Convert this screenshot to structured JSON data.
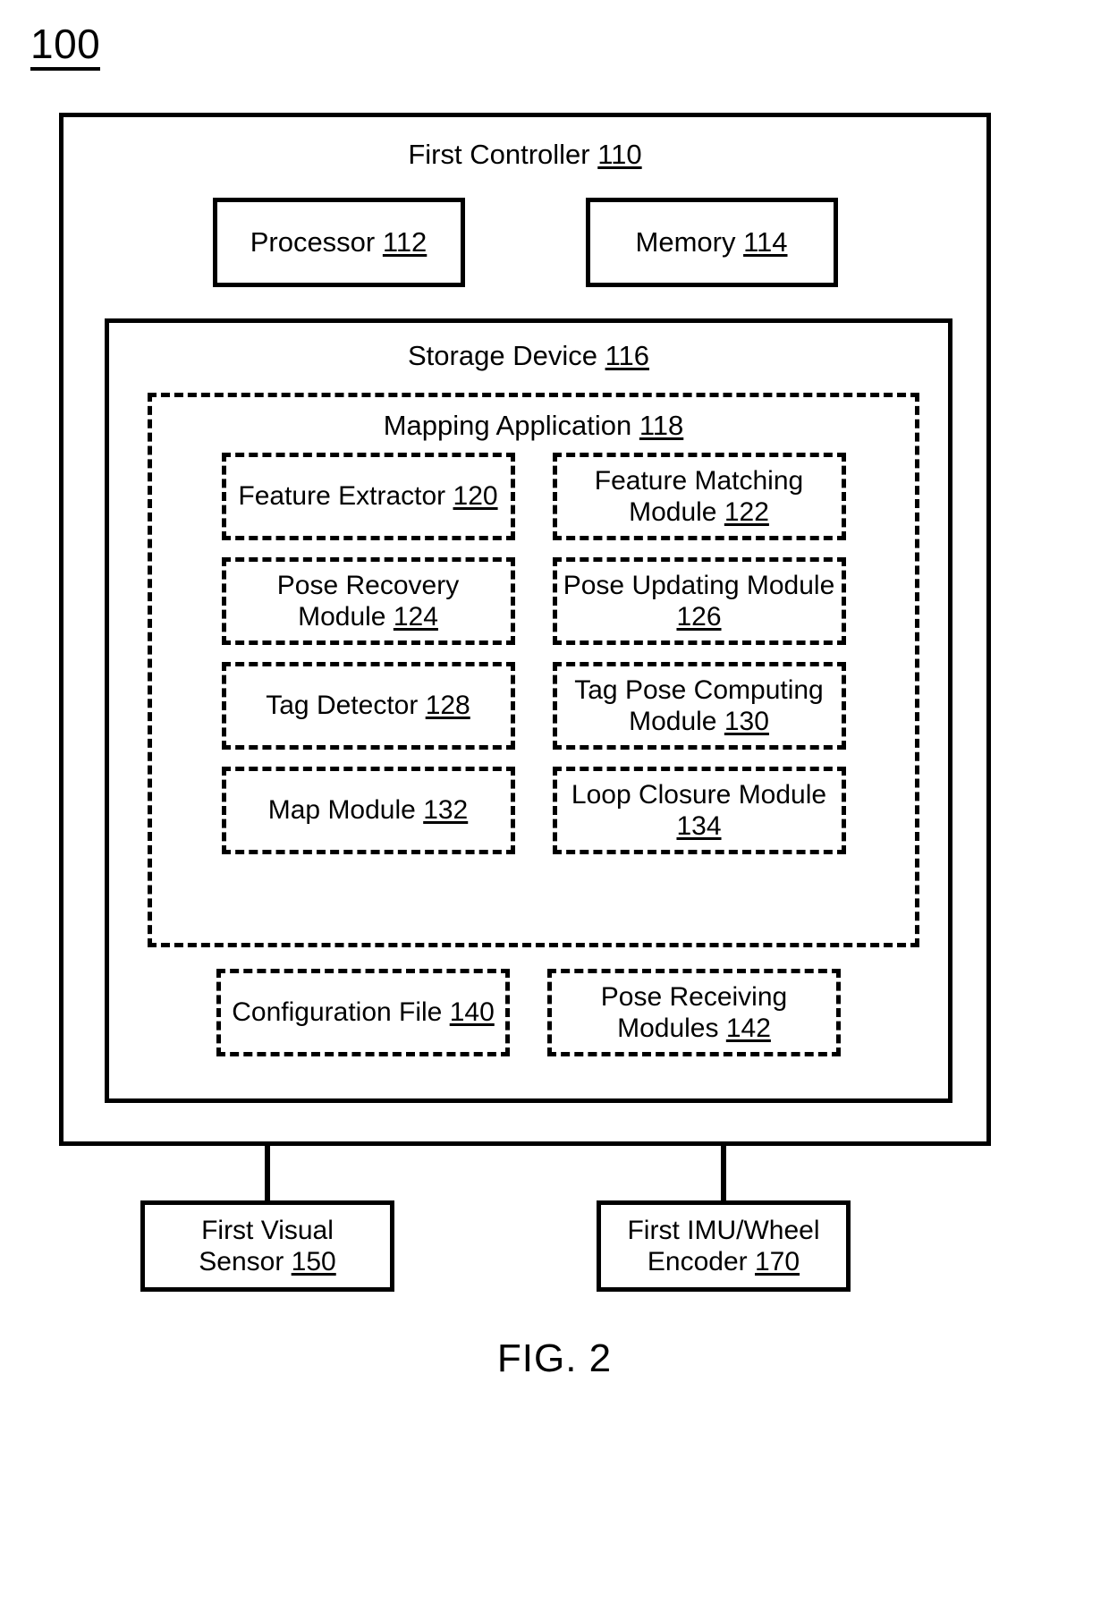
{
  "figure": {
    "system_ref": "100",
    "caption": "FIG. 2"
  },
  "controller": {
    "title_text": "First Controller",
    "title_ref": "110",
    "components": [
      {
        "name": "processor",
        "text": "Processor",
        "ref": "112"
      },
      {
        "name": "memory",
        "text": "Memory",
        "ref": "114"
      }
    ],
    "storage": {
      "title_text": "Storage Device",
      "title_ref": "116",
      "mapping_application": {
        "title_text": "Mapping Application",
        "title_ref": "118",
        "modules": [
          [
            {
              "name": "feature-extractor",
              "lines": [
                "Feature Extractor"
              ],
              "ref": "120",
              "ref_inline": true
            },
            {
              "name": "feature-matching-module",
              "lines": [
                "Feature Matching",
                "Module"
              ],
              "ref": "122",
              "ref_inline": true
            }
          ],
          [
            {
              "name": "pose-recovery-module",
              "lines": [
                "Pose Recovery",
                "Module"
              ],
              "ref": "124",
              "ref_inline": true
            },
            {
              "name": "pose-updating-module",
              "lines": [
                "Pose Updating Module"
              ],
              "ref": "126",
              "ref_inline": false
            }
          ],
          [
            {
              "name": "tag-detector",
              "lines": [
                "Tag Detector"
              ],
              "ref": "128",
              "ref_inline": true
            },
            {
              "name": "tag-pose-computing-module",
              "lines": [
                "Tag Pose Computing",
                "Module"
              ],
              "ref": "130",
              "ref_inline": true
            }
          ],
          [
            {
              "name": "map-module",
              "lines": [
                "Map Module"
              ],
              "ref": "132",
              "ref_inline": true
            },
            {
              "name": "loop-closure-module",
              "lines": [
                "Loop Closure Module"
              ],
              "ref": "134",
              "ref_inline": false
            }
          ]
        ]
      },
      "files": [
        {
          "name": "configuration-file",
          "lines": [
            "Configuration File"
          ],
          "ref": "140",
          "ref_inline": true
        },
        {
          "name": "pose-receiving-modules",
          "lines": [
            "Pose Receiving",
            "Modules"
          ],
          "ref": "142",
          "ref_inline": true
        }
      ]
    }
  },
  "sensors": [
    {
      "name": "first-visual-sensor",
      "line1": "First Visual",
      "line2": "Sensor",
      "ref": "150"
    },
    {
      "name": "first-imu-wheel-encoder",
      "line1": "First IMU/Wheel",
      "line2": "Encoder",
      "ref": "170"
    }
  ]
}
